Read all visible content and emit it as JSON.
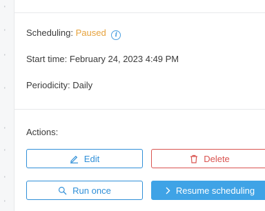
{
  "scheduling": {
    "label": "Scheduling:",
    "status": "Paused",
    "status_color": "#e6a23c"
  },
  "start_time": {
    "label": "Start time:",
    "value": "February 24, 2023 4:49 PM"
  },
  "periodicity": {
    "label": "Periodicity:",
    "value": "Daily"
  },
  "actions": {
    "label": "Actions:",
    "edit": "Edit",
    "delete": "Delete",
    "run_once": "Run once",
    "resume": "Resume scheduling"
  },
  "colors": {
    "primary": "#2f8fd8",
    "danger": "#d9534f",
    "primary_solid": "#3fa3e6"
  },
  "icons": [
    "info-icon",
    "pencil-icon",
    "trash-icon",
    "search-icon",
    "chevron-right-icon"
  ]
}
